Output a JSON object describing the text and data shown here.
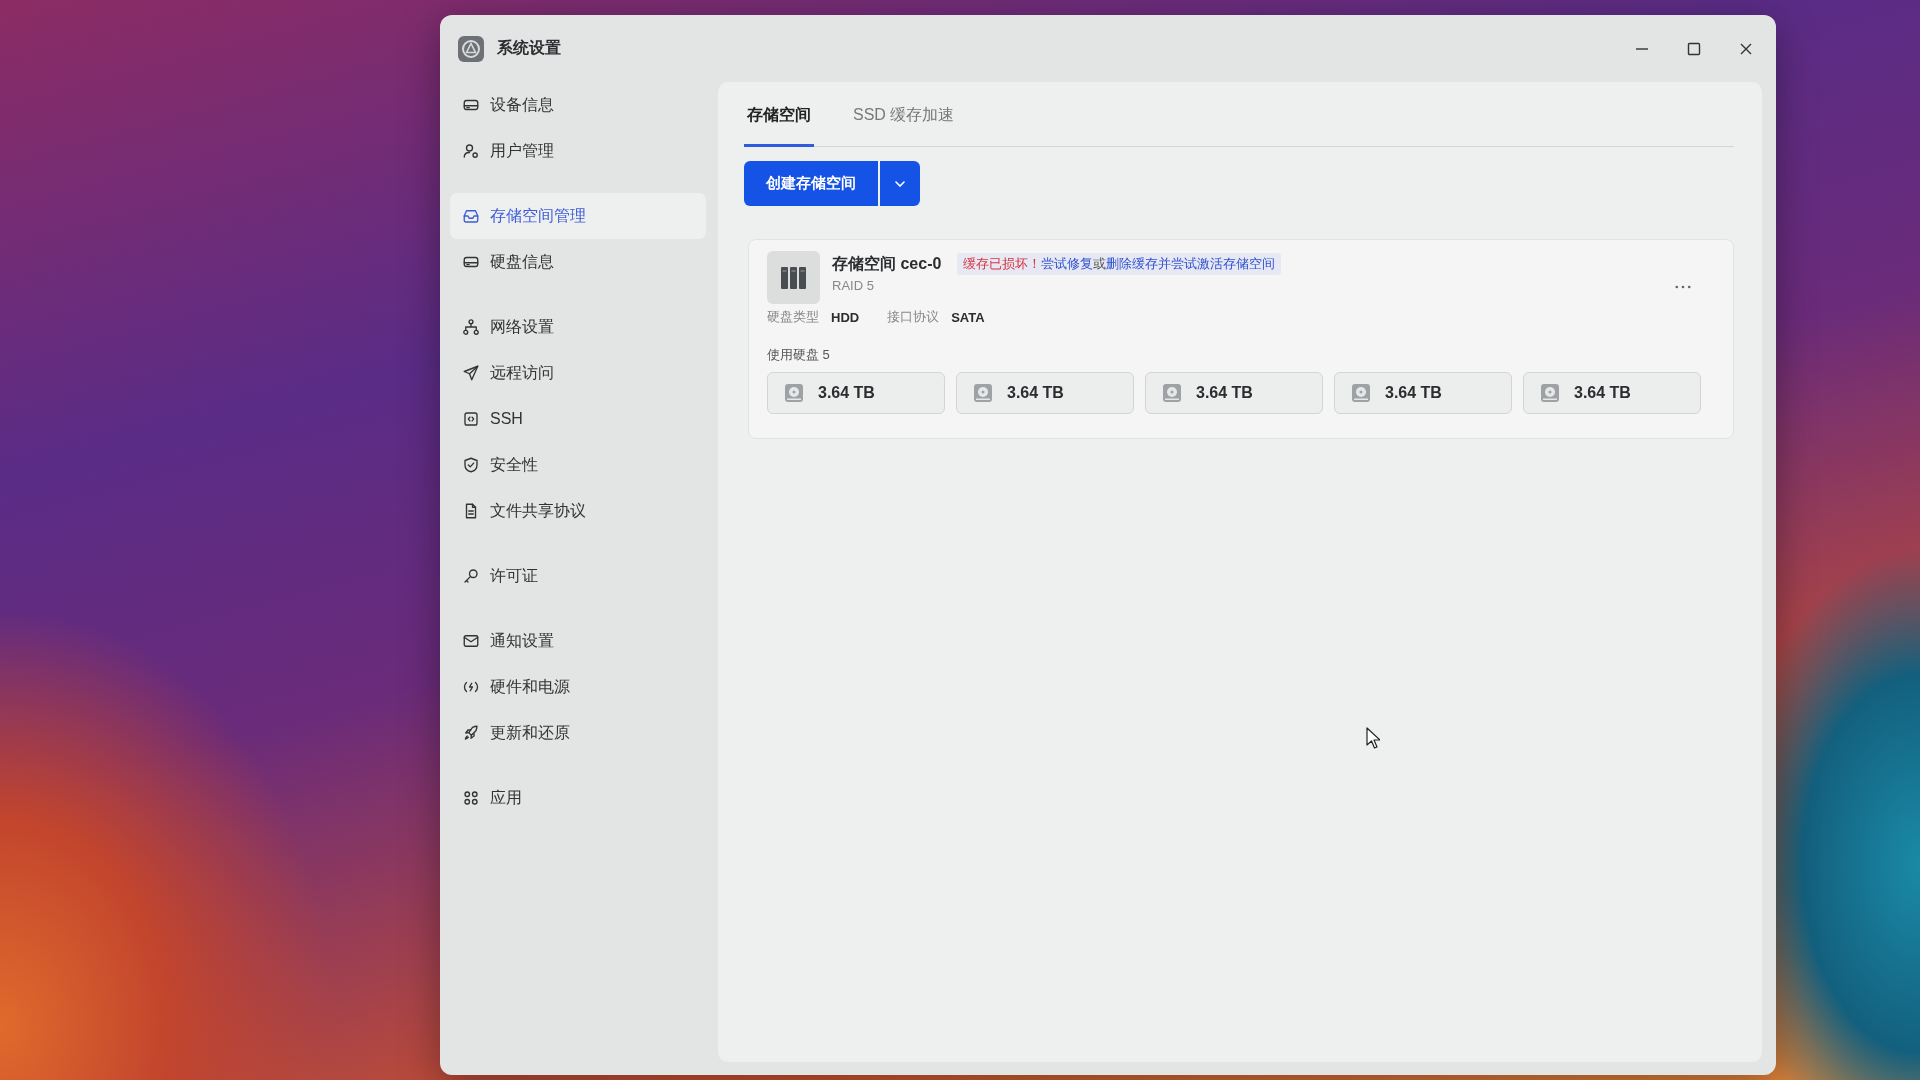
{
  "window": {
    "title": "系统设置"
  },
  "sidebar": {
    "groups": [
      {
        "items": [
          {
            "label": "设备信息",
            "selected": false
          },
          {
            "label": "用户管理",
            "selected": false
          }
        ]
      },
      {
        "items": [
          {
            "label": "存储空间管理",
            "selected": true
          },
          {
            "label": "硬盘信息",
            "selected": false
          }
        ]
      },
      {
        "items": [
          {
            "label": "网络设置",
            "selected": false
          },
          {
            "label": "远程访问",
            "selected": false
          },
          {
            "label": "SSH",
            "selected": false
          },
          {
            "label": "安全性",
            "selected": false
          },
          {
            "label": "文件共享协议",
            "selected": false
          }
        ]
      },
      {
        "items": [
          {
            "label": "许可证",
            "selected": false
          }
        ]
      },
      {
        "items": [
          {
            "label": "通知设置",
            "selected": false
          },
          {
            "label": "硬件和电源",
            "selected": false
          },
          {
            "label": "更新和还原",
            "selected": false
          }
        ]
      },
      {
        "items": [
          {
            "label": "应用",
            "selected": false
          }
        ]
      }
    ]
  },
  "tabs": [
    {
      "label": "存储空间",
      "selected": true
    },
    {
      "label": "SSD 缓存加速",
      "selected": false
    }
  ],
  "toolbar": {
    "create_button": "创建存储空间"
  },
  "storage_pools": [
    {
      "name": "存储空间 cec-0",
      "raid": "RAID 5",
      "alert": {
        "message": "缓存已损坏！",
        "conjunction": "或",
        "actions": [
          {
            "label": "尝试修复"
          },
          {
            "label": "删除缓存并尝试激活存储空间"
          }
        ]
      },
      "details": [
        {
          "label": "硬盘类型",
          "value": "HDD"
        },
        {
          "label": "接口协议",
          "value": "SATA"
        }
      ],
      "disks_label": "使用硬盘 5",
      "disks": [
        {
          "capacity": "3.64 TB"
        },
        {
          "capacity": "3.64 TB"
        },
        {
          "capacity": "3.64 TB"
        },
        {
          "capacity": "3.64 TB"
        },
        {
          "capacity": "3.64 TB"
        }
      ]
    }
  ]
}
